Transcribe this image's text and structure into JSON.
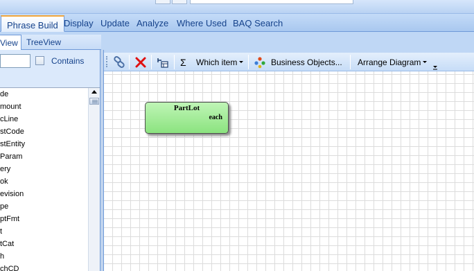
{
  "main_tabs": [
    "Phrase Build",
    "Display",
    "Update",
    "Analyze",
    "Where Used",
    "BAQ Search"
  ],
  "sub_tabs": [
    "View",
    "TreeView"
  ],
  "search": {
    "value": "",
    "contains_label": "Contains"
  },
  "table_list": [
    "de",
    "mount",
    "cLine",
    "stCode",
    "stEntity",
    "Param",
    "ery",
    "ok",
    "evision",
    "pe",
    "ptFmt",
    "t",
    "tCat",
    "h",
    "chCD"
  ],
  "toolbar": {
    "sigma": "Σ",
    "which_item": "Which item",
    "business_objects": "Business Objects...",
    "arrange_diagram": "Arrange Diagram"
  },
  "diagram": {
    "node_title": "PartLot",
    "node_subtitle": "each",
    "node_color": "#8be37f"
  },
  "colors": {
    "active_tab_accent": "#f2a73d",
    "delete_icon": "#e01010"
  }
}
